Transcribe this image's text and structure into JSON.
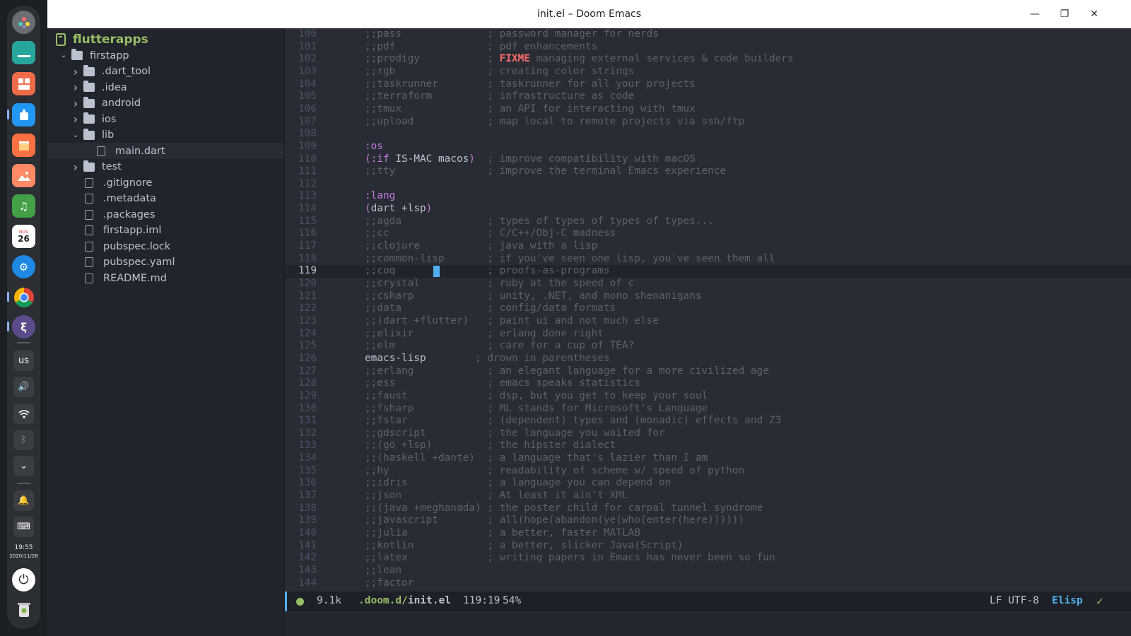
{
  "window": {
    "title": "init.el – Doom Emacs"
  },
  "dock": {
    "keyboard_layout": "us",
    "clock_time": "19:55",
    "clock_date": "2020/11/26",
    "calendar_month": "NOV",
    "calendar_day": "26"
  },
  "sidebar": {
    "project": "flutterapps",
    "tree": [
      {
        "name": "firstapp",
        "kind": "folder",
        "depth": 0,
        "expanded": true
      },
      {
        "name": ".dart_tool",
        "kind": "folder",
        "depth": 1,
        "expanded": false
      },
      {
        "name": ".idea",
        "kind": "folder",
        "depth": 1,
        "expanded": false
      },
      {
        "name": "android",
        "kind": "folder",
        "depth": 1,
        "expanded": false
      },
      {
        "name": "ios",
        "kind": "folder",
        "depth": 1,
        "expanded": false
      },
      {
        "name": "lib",
        "kind": "folder",
        "depth": 1,
        "expanded": true
      },
      {
        "name": "main.dart",
        "kind": "file",
        "depth": 2,
        "selected": true
      },
      {
        "name": "test",
        "kind": "folder",
        "depth": 1,
        "expanded": false
      },
      {
        "name": ".gitignore",
        "kind": "file",
        "depth": 1
      },
      {
        "name": ".metadata",
        "kind": "file",
        "depth": 1
      },
      {
        "name": ".packages",
        "kind": "file",
        "depth": 1
      },
      {
        "name": "firstapp.iml",
        "kind": "file",
        "depth": 1
      },
      {
        "name": "pubspec.lock",
        "kind": "file",
        "depth": 1
      },
      {
        "name": "pubspec.yaml",
        "kind": "file",
        "depth": 1
      },
      {
        "name": "README.md",
        "kind": "file",
        "depth": 1
      }
    ]
  },
  "editor": {
    "current_line": "119",
    "lines": [
      {
        "n": "100",
        "seg": [
          [
            "c",
            ";;pass              ; password manager for nerds"
          ]
        ]
      },
      {
        "n": "101",
        "seg": [
          [
            "c",
            ";;pdf               ; pdf enhancements"
          ]
        ]
      },
      {
        "n": "102",
        "seg": [
          [
            "c",
            ";;prodigy           ; "
          ],
          [
            "f",
            "FIXME"
          ],
          [
            "c",
            " managing external services & code builders"
          ]
        ]
      },
      {
        "n": "103",
        "seg": [
          [
            "c",
            ";;rgb               ; creating color strings"
          ]
        ]
      },
      {
        "n": "104",
        "seg": [
          [
            "c",
            ";;taskrunner        ; taskrunner for all your projects"
          ]
        ]
      },
      {
        "n": "105",
        "seg": [
          [
            "c",
            ";;terraform         ; infrastructure as code"
          ]
        ]
      },
      {
        "n": "106",
        "seg": [
          [
            "c",
            ";;tmux              ; an API for interacting with tmux"
          ]
        ]
      },
      {
        "n": "107",
        "seg": [
          [
            "c",
            ";;upload            ; map local to remote projects via ssh/ftp"
          ]
        ]
      },
      {
        "n": "108",
        "seg": []
      },
      {
        "n": "109",
        "seg": [
          [
            "k",
            ":os"
          ]
        ]
      },
      {
        "n": "110",
        "seg": [
          [
            "k",
            "(:if "
          ],
          [
            "p",
            "IS-MAC macos"
          ],
          [
            "k",
            ")"
          ],
          [
            "c",
            "  ; improve compatibility with macOS"
          ]
        ]
      },
      {
        "n": "111",
        "seg": [
          [
            "c",
            ";;tty               ; improve the terminal Emacs experience"
          ]
        ]
      },
      {
        "n": "112",
        "seg": []
      },
      {
        "n": "113",
        "seg": [
          [
            "k",
            ":lang"
          ]
        ]
      },
      {
        "n": "114",
        "seg": [
          [
            "k",
            "("
          ],
          [
            "p",
            "dart +lsp"
          ],
          [
            "k",
            ")"
          ]
        ]
      },
      {
        "n": "115",
        "seg": [
          [
            "c",
            ";;agda              ; types of types of types of types..."
          ]
        ]
      },
      {
        "n": "116",
        "seg": [
          [
            "c",
            ";;cc                ; C/C++/Obj-C madness"
          ]
        ]
      },
      {
        "n": "117",
        "seg": [
          [
            "c",
            ";;clojure           ; java with a lisp"
          ]
        ]
      },
      {
        "n": "118",
        "seg": [
          [
            "c",
            ";;common-lisp       ; if you've seen one lisp, you've seen them all"
          ]
        ]
      },
      {
        "n": "119",
        "seg": [
          [
            "c",
            ";;coq               ; proofs-as-programs"
          ]
        ]
      },
      {
        "n": "120",
        "seg": [
          [
            "c",
            ";;crystal           ; ruby at the speed of c"
          ]
        ]
      },
      {
        "n": "121",
        "seg": [
          [
            "c",
            ";;csharp            ; unity, .NET, and mono shenanigans"
          ]
        ]
      },
      {
        "n": "122",
        "seg": [
          [
            "c",
            ";;data              ; config/data formats"
          ]
        ]
      },
      {
        "n": "123",
        "seg": [
          [
            "c",
            ";;(dart +flutter)   ; paint ui and not much else"
          ]
        ]
      },
      {
        "n": "124",
        "seg": [
          [
            "c",
            ";;elixir            ; erlang done right"
          ]
        ]
      },
      {
        "n": "125",
        "seg": [
          [
            "c",
            ";;elm               ; care for a cup of TEA?"
          ]
        ]
      },
      {
        "n": "126",
        "seg": [
          [
            "p",
            "emacs-lisp"
          ],
          [
            "c",
            "        ; drown in parentheses"
          ]
        ]
      },
      {
        "n": "127",
        "seg": [
          [
            "c",
            ";;erlang            ; an elegant language for a more civilized age"
          ]
        ]
      },
      {
        "n": "128",
        "seg": [
          [
            "c",
            ";;ess               ; emacs speaks statistics"
          ]
        ]
      },
      {
        "n": "129",
        "seg": [
          [
            "c",
            ";;faust             ; dsp, but you get to keep your soul"
          ]
        ]
      },
      {
        "n": "130",
        "seg": [
          [
            "c",
            ";;fsharp            ; ML stands for Microsoft's Language"
          ]
        ]
      },
      {
        "n": "131",
        "seg": [
          [
            "c",
            ";;fstar             ; (dependent) types and (monadic) effects and Z3"
          ]
        ]
      },
      {
        "n": "132",
        "seg": [
          [
            "c",
            ";;gdscript          ; the language you waited for"
          ]
        ]
      },
      {
        "n": "133",
        "seg": [
          [
            "c",
            ";;(go +lsp)         ; the hipster dialect"
          ]
        ]
      },
      {
        "n": "134",
        "seg": [
          [
            "c",
            ";;(haskell +dante)  ; a language that's lazier than I am"
          ]
        ]
      },
      {
        "n": "135",
        "seg": [
          [
            "c",
            ";;hy                ; readability of scheme w/ speed of python"
          ]
        ]
      },
      {
        "n": "136",
        "seg": [
          [
            "c",
            ";;idris             ; a language you can depend on"
          ]
        ]
      },
      {
        "n": "137",
        "seg": [
          [
            "c",
            ";;json              ; At least it ain't XML"
          ]
        ]
      },
      {
        "n": "138",
        "seg": [
          [
            "c",
            ";;(java +meghanada) ; the poster child for carpal tunnel syndrome"
          ]
        ]
      },
      {
        "n": "139",
        "seg": [
          [
            "c",
            ";;javascript        ; all(hope(abandon(ye(who(enter(here))))))"
          ]
        ]
      },
      {
        "n": "140",
        "seg": [
          [
            "c",
            ";;julia             ; a better, faster MATLAB"
          ]
        ]
      },
      {
        "n": "141",
        "seg": [
          [
            "c",
            ";;kotlin            ; a better, slicker Java(Script)"
          ]
        ]
      },
      {
        "n": "142",
        "seg": [
          [
            "c",
            ";;latex             ; writing papers in Emacs has never been so fun"
          ]
        ]
      },
      {
        "n": "143",
        "seg": [
          [
            "c",
            ";;lean"
          ]
        ]
      },
      {
        "n": "144",
        "seg": [
          [
            "c",
            ";;factor"
          ]
        ]
      }
    ]
  },
  "modeline": {
    "size": "9.1k",
    "path": ".doom.d/",
    "filename": "init.el",
    "position": "119:19",
    "percent": "54%",
    "eol_encoding": "LF UTF-8",
    "major_mode": "Elisp",
    "status_icon": "check-icon"
  },
  "colors": {
    "accent": "#51afef",
    "green": "#98be65",
    "keyword": "#c678dd",
    "fixme": "#ff6c6b",
    "comment": "#5b6268",
    "bg": "#282c34"
  }
}
